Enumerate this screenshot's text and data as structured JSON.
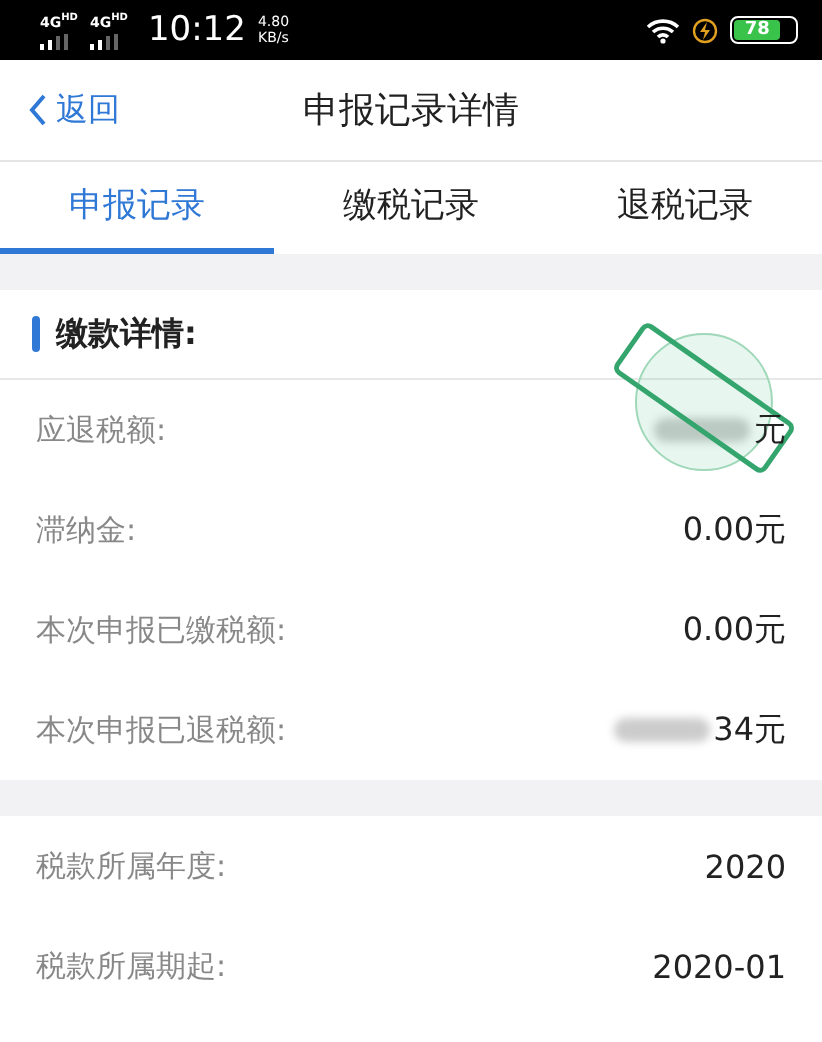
{
  "status_bar": {
    "signal_1": "4G",
    "signal_1_tag": "HD",
    "signal_2": "4G",
    "signal_2_tag": "HD",
    "time": "10:12",
    "speed": "4.80",
    "speed_unit": "KB/s",
    "battery": "78",
    "charging": true
  },
  "nav": {
    "back": "返回",
    "title": "申报记录详情"
  },
  "tabs": [
    {
      "label": "申报记录",
      "selected": true
    },
    {
      "label": "缴税记录",
      "selected": false
    },
    {
      "label": "退税记录",
      "selected": false
    }
  ],
  "section": {
    "title": "缴款详情:"
  },
  "rows": [
    {
      "label": "应退税额:",
      "value": "元",
      "blurred": true,
      "stamp": true
    },
    {
      "label": "滞纳金:",
      "value": "0.00元",
      "blurred": false,
      "stamp": false
    },
    {
      "label": "本次申报已缴税额:",
      "value": "0.00元",
      "blurred": false,
      "stamp": false
    },
    {
      "label": "本次申报已退税额:",
      "value": "34元",
      "blurred": true,
      "stamp": false
    }
  ],
  "rows_2": [
    {
      "label": "税款所属年度:",
      "value": "2020"
    },
    {
      "label": "税款所属期起:",
      "value": "2020-01"
    }
  ]
}
